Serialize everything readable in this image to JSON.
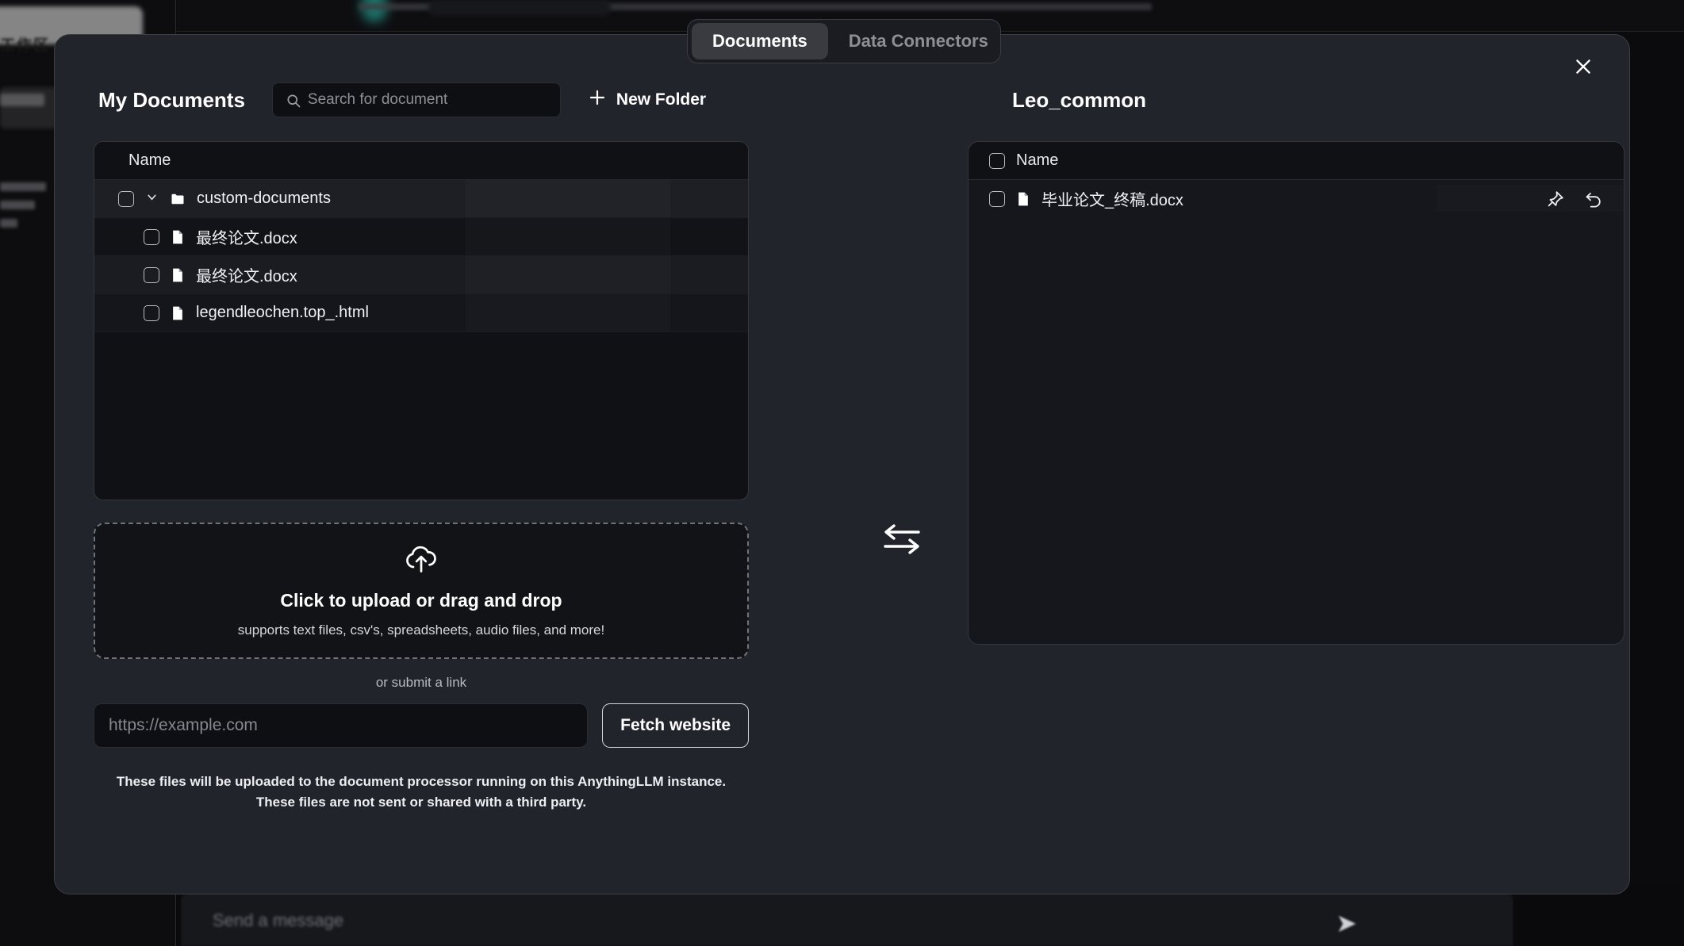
{
  "background": {
    "compose_placeholder": "Send a message",
    "send_icon": "send-arrow-icon"
  },
  "tabs": [
    {
      "label": "Documents",
      "active": true
    },
    {
      "label": "Data Connectors",
      "active": false
    }
  ],
  "modal": {
    "close_icon": "close-icon"
  },
  "left_panel": {
    "title": "My Documents",
    "search": {
      "placeholder": "Search for document",
      "value": "",
      "icon": "search-icon"
    },
    "new_folder": {
      "label": "New Folder",
      "icon": "plus-icon"
    },
    "list": {
      "header": "Name",
      "rows": [
        {
          "name": "custom-documents",
          "type": "folder",
          "icon": "folder-icon",
          "chevron": "chevron-down-icon",
          "checked": false
        },
        {
          "name": "最终论文.docx",
          "type": "file",
          "icon": "file-icon",
          "checked": false
        },
        {
          "name": "最终论文.docx",
          "type": "file",
          "icon": "file-icon",
          "checked": false
        },
        {
          "name": "legendleochen.top_.html",
          "type": "file",
          "icon": "file-icon",
          "checked": false
        }
      ]
    },
    "upload": {
      "icon": "cloud-upload-icon",
      "title": "Click to upload or drag and drop",
      "subtitle": "supports text files, csv's, spreadsheets, audio files, and more!"
    },
    "or_submit": "or submit a link",
    "url_input": {
      "placeholder": "https://example.com",
      "value": ""
    },
    "fetch_button": "Fetch website",
    "disclaimer_line1": "These files will be uploaded to the document processor running on this AnythingLLM instance.",
    "disclaimer_line2": "These files are not sent or shared with a third party."
  },
  "swap": {
    "icon": "swap-arrows-icon"
  },
  "right_panel": {
    "title": "Leo_common",
    "list": {
      "header": "Name",
      "rows": [
        {
          "name": "毕业论文_终稿.docx",
          "type": "file",
          "icon": "file-icon",
          "checked": false,
          "actions": [
            {
              "icon": "pin-icon"
            },
            {
              "icon": "undo-icon"
            }
          ]
        }
      ]
    }
  },
  "colors": {
    "modal_bg": "#22242b",
    "panel_bg": "#101114",
    "accent_active_tab": "#3a3b40",
    "text_primary": "#ffffff",
    "text_muted": "#8d8f96"
  }
}
